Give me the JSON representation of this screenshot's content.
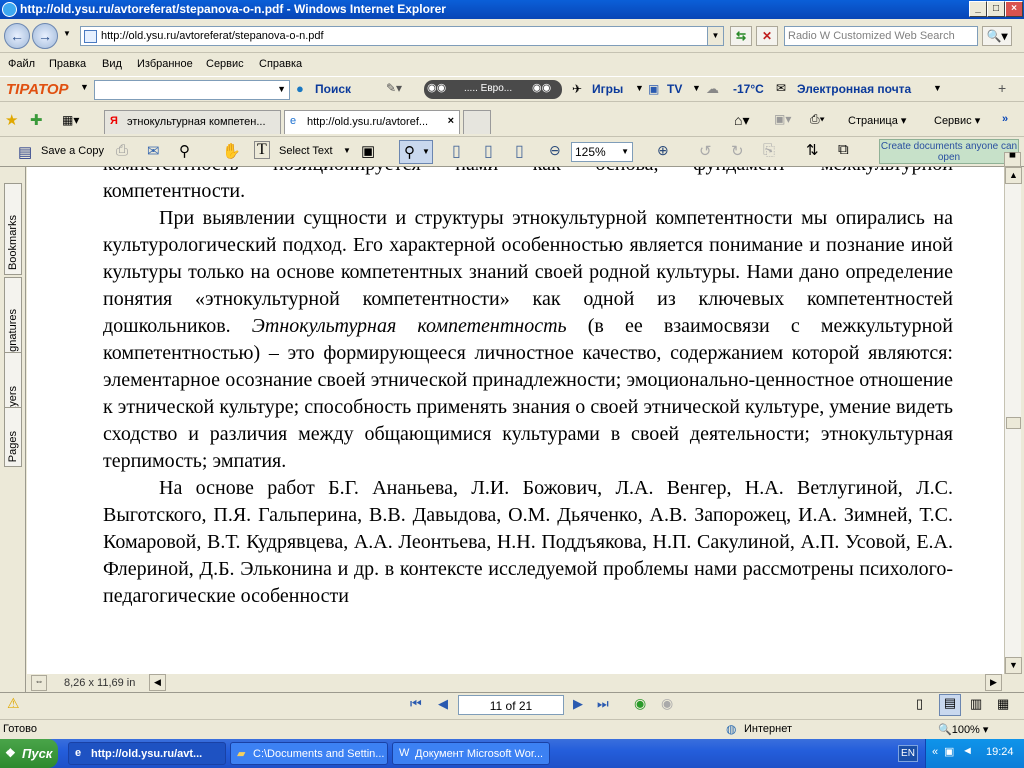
{
  "window": {
    "title": "http://old.ysu.ru/avtoreferat/stepanova-o-n.pdf - Windows Internet Explorer"
  },
  "address_bar": {
    "url": "http://old.ysu.ru/avtoreferat/stepanova-o-n.pdf"
  },
  "search": {
    "placeholder": "Radio W Customized Web Search"
  },
  "menu": [
    "Файл",
    "Правка",
    "Вид",
    "Избранное",
    "Сервис",
    "Справка"
  ],
  "toolbar2": {
    "brand": "TIPATOP",
    "search_label": "Поиск",
    "radio_label": "..... Евро...",
    "games_label": "Игры",
    "tv_label": "TV",
    "weather_label": "-17°C",
    "mail_label": "Электронная почта"
  },
  "tabs": [
    {
      "label": "этнокультурная компетен..."
    },
    {
      "label": "http://old.ysu.ru/avtoref..."
    }
  ],
  "command_bar": {
    "page_label": "Страница",
    "tools_label": "Сервис"
  },
  "pdf_toolbar": {
    "save_copy": "Save a Copy",
    "select_text": "Select Text",
    "zoom": "125%",
    "create_docs": "Create documents anyone can open"
  },
  "side_tabs": [
    "Bookmarks",
    "Signatures",
    "Layers",
    "Pages"
  ],
  "document": {
    "line0": "компетентность позиционируется нами как основа, фундамент межкультурной",
    "line1": "компетентности.",
    "para1_a": "При выявлении сущности и структуры этнокультурной компетентности мы опирались на культурологический подход. Его характерной особенностью является понимание и познание иной культуры только на основе компетентных знаний своей родной культуры. Нами дано определение понятия «этнокультурной компетентности» как одной из ключевых компетентностей дошкольников. ",
    "para1_italic": "Этнокультурная компетентность",
    "para1_b": " (в ее взаимосвязи с межкультурной компетентностью) – это формирующееся личностное  качество, содержанием которой являются: элементарное осознание своей этнической принадлежности; эмоционально-ценностное отношение к  этнической культуре; способность применять знания о своей этнической культуре, умение видеть сходство и различия между общающимися культурами в своей деятельности; этнокультурная терпимость; эмпатия.",
    "para2": "На основе работ Б.Г. Ананьева, Л.И. Божович, Л.А. Венгер, Н.А. Ветлугиной, Л.С. Выготского, П.Я. Гальперина, В.В. Давыдова, О.М. Дьяченко, А.В. Запорожец, И.А. Зимней, Т.С. Комаровой, В.Т. Кудрявцева, А.А. Леонтьева, Н.Н. Поддъякова, Н.П. Сакулиной, А.П. Усовой, Е.А. Флериной, Д.Б. Эльконина и др. в контексте исследуемой проблемы нами рассмотрены психолого-педагогические особенности"
  },
  "page_size": "8,26 x 11,69 in",
  "page_nav": {
    "current": "11 of 21"
  },
  "status": {
    "left": "Готово",
    "zone": "Интернет",
    "zoom": "100%"
  },
  "taskbar": {
    "start": "Пуск",
    "tasks": [
      "http://old.ysu.ru/avt...",
      "C:\\Documents and Settin...",
      "Документ Microsoft Wor..."
    ],
    "lang": "EN",
    "clock": "19:24"
  }
}
